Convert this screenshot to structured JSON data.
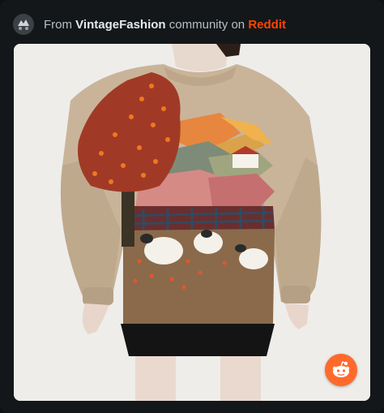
{
  "header": {
    "prefix": "From",
    "community": "VintageFashion",
    "middle": "community on",
    "platform": "Reddit",
    "avatar_icon": "community-avatar-icon"
  },
  "media": {
    "icon": "reddit-snoo-icon"
  },
  "colors": {
    "brand": "#ff4500",
    "badge": "#ff6a2c",
    "background": "#131719"
  }
}
